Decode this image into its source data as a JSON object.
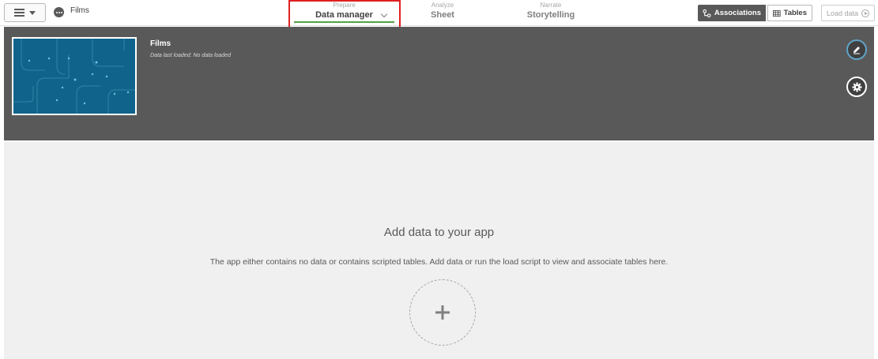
{
  "topbar": {
    "app_title": "Films",
    "tabs": [
      {
        "small": "Prepare",
        "big": "Data manager"
      },
      {
        "small": "Analyze",
        "big": "Sheet"
      },
      {
        "small": "Narrate",
        "big": "Storytelling"
      }
    ],
    "associations_label": "Associations",
    "tables_label": "Tables",
    "load_data_label": "Load data"
  },
  "banner": {
    "title": "Films",
    "subtitle": "Data last loaded: No data loaded"
  },
  "content": {
    "title": "Add data to your app",
    "description": "The app either contains no data or contains scripted tables. Add data or run the load script to view and associate tables here."
  },
  "colors": {
    "accent_green": "#52a342",
    "banner_bg": "#595959",
    "thumb_bg": "#10648c",
    "highlight_red": "#e02020"
  }
}
